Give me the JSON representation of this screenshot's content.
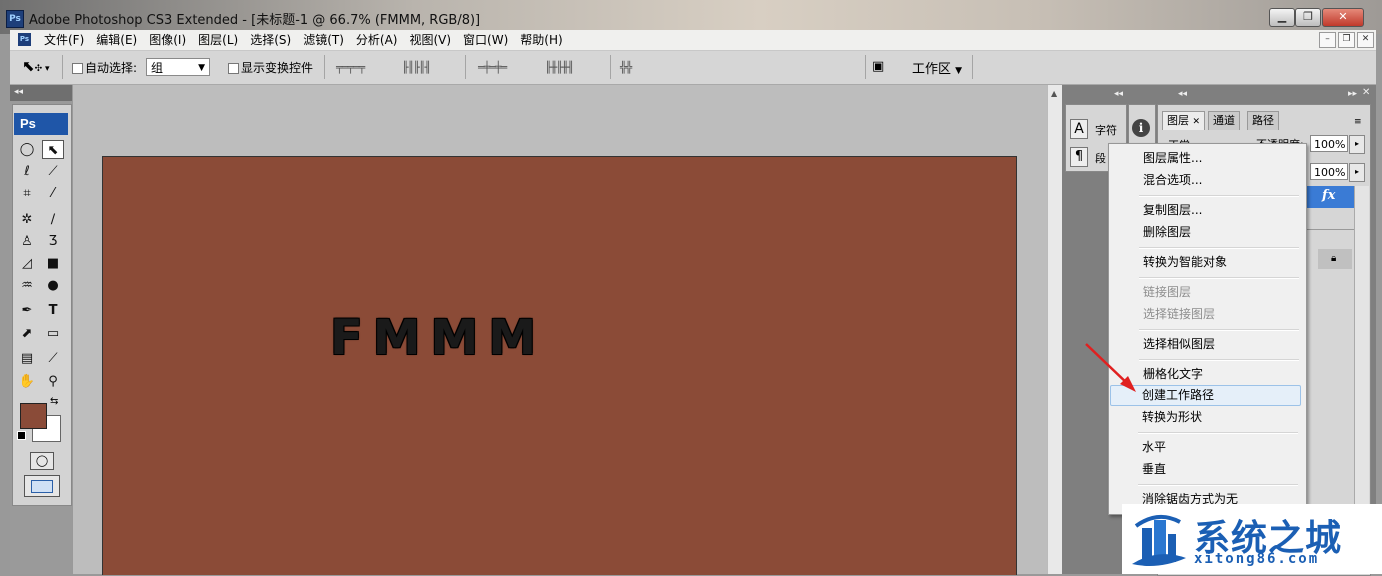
{
  "window": {
    "title": "Adobe Photoshop CS3 Extended - [未标题-1 @ 66.7% (FMMM, RGB/8)]",
    "icon_label": "Ps",
    "buttons": {
      "minimize": "▁",
      "restore": "❐",
      "close": "✕"
    }
  },
  "menubar": {
    "icon_label": "Ps",
    "items": [
      "文件(F)",
      "编辑(E)",
      "图像(I)",
      "图层(L)",
      "选择(S)",
      "滤镜(T)",
      "分析(A)",
      "视图(V)",
      "窗口(W)",
      "帮助(H)"
    ],
    "doc_buttons": {
      "minimize": "–",
      "restore": "❐",
      "close": "✕"
    }
  },
  "options": {
    "auto_select_label": "自动选择:",
    "auto_select_value": "组",
    "show_transform_label": "显示变换控件",
    "workspace_label": "工作区"
  },
  "toolbox": {
    "logo": "Ps",
    "tool_icons": [
      "marquee-icon",
      "move-icon",
      "lasso-icon",
      "magic-wand-icon",
      "crop-icon",
      "slice-icon",
      "healing-icon",
      "brush-icon",
      "stamp-icon",
      "history-brush-icon",
      "eraser-icon",
      "gradient-icon",
      "blur-icon",
      "dodge-icon",
      "pen-icon",
      "type-icon",
      "path-select-icon",
      "shape-icon",
      "notes-icon",
      "eyedropper-icon",
      "hand-icon",
      "zoom-icon"
    ],
    "foreground_color": "#8a4b38",
    "background_color": "#ffffff"
  },
  "canvas": {
    "text": "FMMM",
    "background": "#8b4b37"
  },
  "panels": {
    "character_label": "字符",
    "paragraph_label": "段",
    "tabs": [
      "图层",
      "通道",
      "路径"
    ],
    "blend_mode": "正常",
    "opacity_label": "不透明度:",
    "opacity_value": "100%",
    "fill_value": "100%",
    "fx_label": "fx"
  },
  "context_menu": {
    "items": [
      {
        "label": "图层属性...",
        "disabled": false
      },
      {
        "label": "混合选项...",
        "disabled": false
      },
      {
        "label": "复制图层...",
        "disabled": false
      },
      {
        "label": "删除图层",
        "disabled": false
      },
      {
        "label": "转换为智能对象",
        "disabled": false
      },
      {
        "label": "链接图层",
        "disabled": true
      },
      {
        "label": "选择链接图层",
        "disabled": true
      },
      {
        "label": "选择相似图层",
        "disabled": false
      },
      {
        "label": "栅格化文字",
        "disabled": false
      },
      {
        "label": "创建工作路径",
        "disabled": false,
        "highlighted": true
      },
      {
        "label": "转换为形状",
        "disabled": false
      },
      {
        "label": "水平",
        "disabled": false
      },
      {
        "label": "垂直",
        "disabled": false
      },
      {
        "label": "消除锯齿方式为无",
        "disabled": false
      }
    ]
  },
  "watermark": {
    "title": "系统之城",
    "url": "xitong86.com",
    "color": "#1b5fb4"
  },
  "annotation": {
    "arrow_color": "#e02020"
  }
}
